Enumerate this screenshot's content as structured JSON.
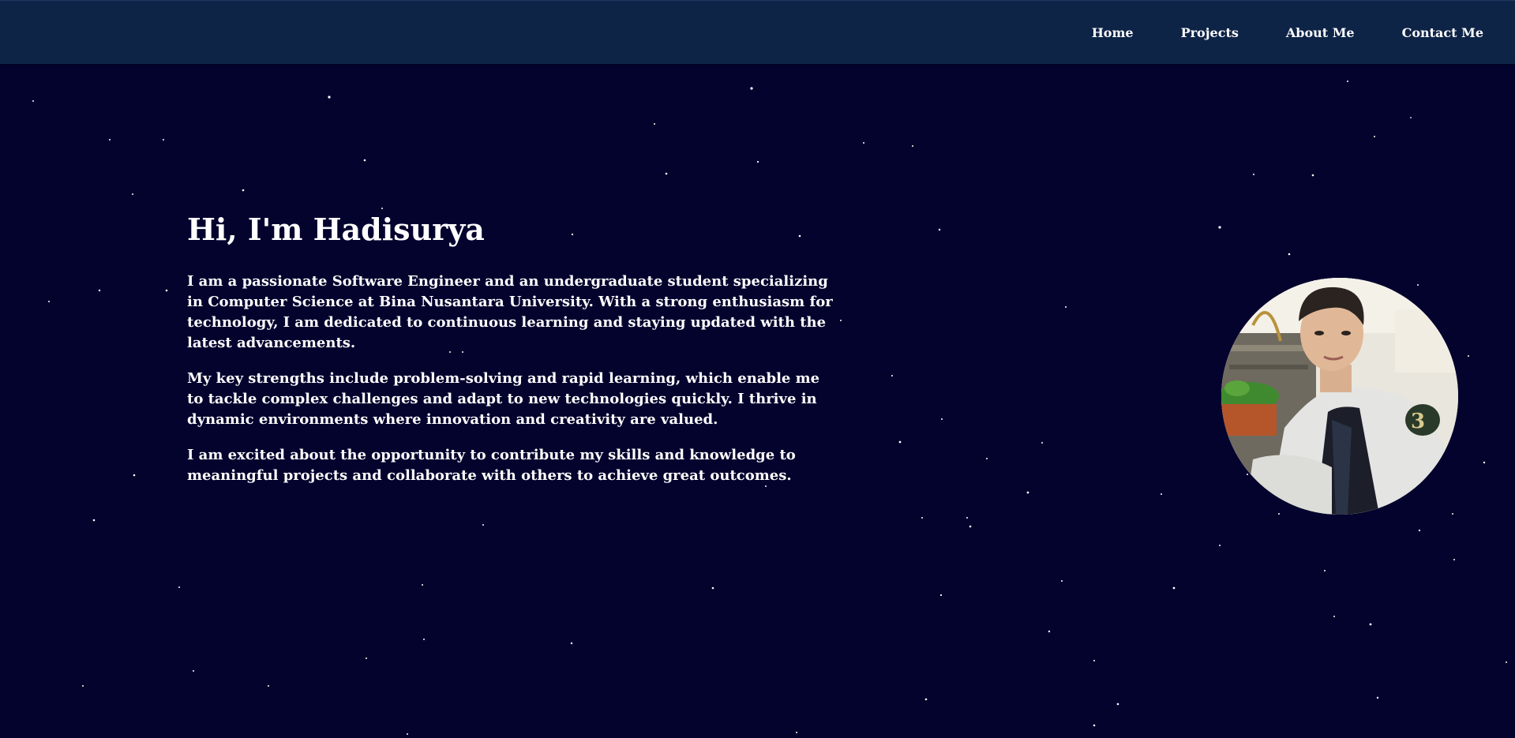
{
  "nav": {
    "items": [
      {
        "label": "Home"
      },
      {
        "label": "Projects"
      },
      {
        "label": "About Me"
      },
      {
        "label": "Contact Me"
      }
    ]
  },
  "hero": {
    "heading": "Hi, I'm Hadisurya",
    "paragraphs": [
      "I am a passionate Software Engineer and an undergraduate student specializing in Computer Science at Bina Nusantara University. With a strong enthusiasm for technology, I am dedicated to continuous learning and staying updated with the latest advancements.",
      "My key strengths include problem-solving and rapid learning, which enable me to tackle complex challenges and adapt to new technologies quickly. I thrive in dynamic environments where innovation and creativity are valued.",
      "I am excited about the opportunity to contribute my skills and knowledge to meaningful projects and collaborate with others to achieve great outcomes."
    ]
  },
  "colors": {
    "background": "#03032e",
    "navbar": "#0e2447",
    "text": "#ffffff"
  }
}
